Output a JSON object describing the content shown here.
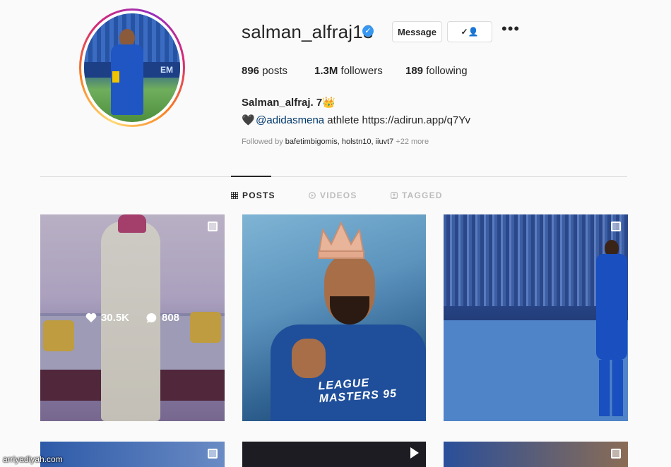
{
  "profile": {
    "username": "salman_alfraj13",
    "verified_glyph": "✓",
    "full_name": "Salman_alfraj. 7👑",
    "bio_heart": "🖤",
    "bio_mention": "@adidasmena",
    "bio_rest": " athlete https://adirun.app/q7Yv",
    "followed_by_prefix": "Followed by ",
    "followed_by_names": "bafetimbigomis, holstn10, iiuvt7",
    "followed_by_more": " +22 more"
  },
  "actions": {
    "message_label": "Message",
    "follow_icon": "✓👤",
    "more_icon": "•••"
  },
  "stats": {
    "posts_count": "896",
    "posts_label": " posts",
    "followers_count": "1.3M",
    "followers_label": " followers",
    "following_count": "189",
    "following_label": " following"
  },
  "tabs": {
    "posts": "POSTS",
    "videos": "VIDEOS",
    "tagged": "TAGGED"
  },
  "posts": {
    "first_likes": "30.5K",
    "first_comments": "808",
    "shirt_text": "LEAGUE MASTERS 95"
  },
  "avatar": {
    "banner_text": "EM"
  },
  "watermark": "arriyadiyah.com",
  "colors": {
    "verified": "#3897f0",
    "mention": "#00376b",
    "muted": "#8e8e8e"
  }
}
